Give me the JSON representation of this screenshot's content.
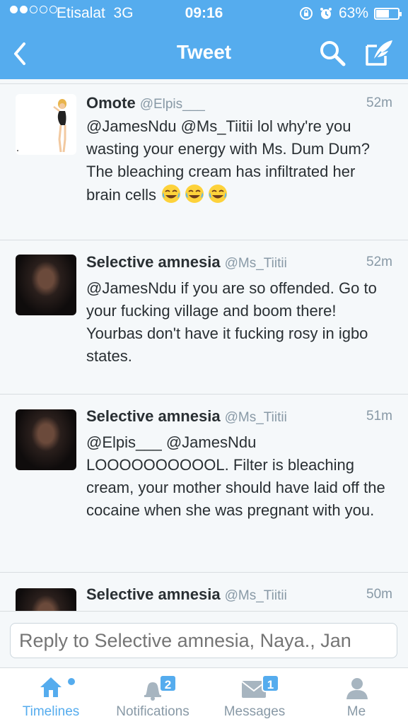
{
  "status_bar": {
    "carrier": "Etisalat",
    "network": "3G",
    "time": "09:16",
    "battery": "63%",
    "battery_level": 0.63,
    "signal_bars_filled": 2,
    "signal_bars_total": 5
  },
  "nav": {
    "title": "Tweet",
    "back_icon": "chevron-left-icon",
    "search_icon": "search-icon",
    "compose_icon": "compose-icon"
  },
  "tweets": [
    {
      "name": "Omote",
      "handle": "@Elpis___",
      "time": "52m",
      "text": "@JamesNdu @Ms_Tiitii lol why're you wasting your energy with Ms. Dum Dum? The bleaching cream has infiltrated her brain cells",
      "emojis": [
        "face-with-tears-of-joy",
        "face-with-tears-of-joy",
        "face-with-tears-of-joy"
      ],
      "avatar": "cartoon-figure-avatar"
    },
    {
      "name": "Selective amnesia",
      "handle": "@Ms_Tiitii",
      "time": "52m",
      "text": "@JamesNdu if you are so offended. Go to your fucking village and boom there! Yourbas don't have it fucking rosy in igbo states.",
      "avatar": "profile-photo-avatar"
    },
    {
      "name": "Selective amnesia",
      "handle": "@Ms_Tiitii",
      "time": "51m",
      "text": "@Elpis___ @JamesNdu LOOOOOOOOOOL. Filter is bleaching cream, your mother should have laid off the cocaine when she was pregnant with you.",
      "avatar": "profile-photo-avatar"
    },
    {
      "name": "Selective amnesia",
      "handle": "@Ms_Tiitii",
      "time": "50m",
      "avatar": "profile-photo-avatar"
    }
  ],
  "reply": {
    "placeholder": "Reply to Selective amnesia, Naya., Jan"
  },
  "tabs": [
    {
      "label": "Timelines",
      "icon": "home-icon",
      "active": true
    },
    {
      "label": "Notifications",
      "icon": "bell-icon",
      "badge": "2"
    },
    {
      "label": "Messages",
      "icon": "envelope-icon",
      "badge": "1"
    },
    {
      "label": "Me",
      "icon": "person-icon"
    }
  ],
  "colors": {
    "brand": "#55acee",
    "background": "#f5f8fa",
    "text": "#292f33",
    "muted": "#8899a6"
  }
}
